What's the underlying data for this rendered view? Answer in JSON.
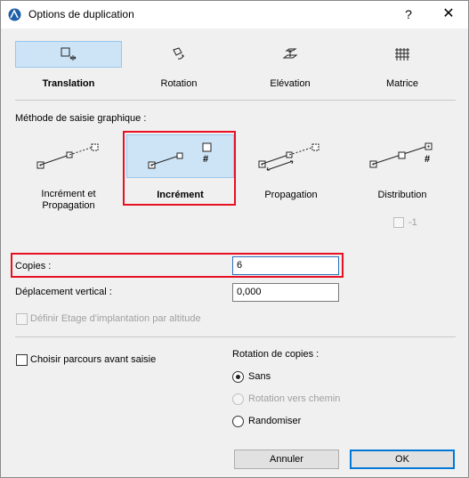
{
  "window": {
    "title": "Options de duplication",
    "help_label": "?",
    "close_label": "✕",
    "app_icon": "archicad-icon"
  },
  "modes": [
    {
      "label": "Translation",
      "icon": "translation-icon",
      "selected": true
    },
    {
      "label": "Rotation",
      "icon": "rotation-icon",
      "selected": false
    },
    {
      "label": "Elévation",
      "icon": "elevation-icon",
      "selected": false
    },
    {
      "label": "Matrice",
      "icon": "matrix-icon",
      "selected": false
    }
  ],
  "method": {
    "section_label": "Méthode de saisie graphique :",
    "options": [
      {
        "label_line1": "Incrément et",
        "label_line2": "Propagation",
        "selected": false
      },
      {
        "label_line1": "Incrément",
        "label_line2": "",
        "selected": true
      },
      {
        "label_line1": "Propagation",
        "label_line2": "",
        "selected": false
      },
      {
        "label_line1": "Distribution",
        "label_line2": "",
        "selected": false
      }
    ],
    "distribution_extra_label": "-1",
    "hash_symbol": "#"
  },
  "fields": {
    "copies_label": "Copies :",
    "copies_value": "6",
    "vertical_label": "Déplacement vertical :",
    "vertical_value": "0,000",
    "floor_checkbox_label": "Définir Etage d'implantation par altitude"
  },
  "options": {
    "path_checkbox_label": "Choisir parcours avant saisie",
    "rotation_title": "Rotation de copies :",
    "rotation_options": [
      {
        "label": "Sans",
        "checked": true,
        "enabled": true
      },
      {
        "label": "Rotation vers chemin",
        "checked": false,
        "enabled": false
      },
      {
        "label": "Randomiser",
        "checked": false,
        "enabled": true
      }
    ]
  },
  "buttons": {
    "cancel": "Annuler",
    "ok": "OK"
  }
}
